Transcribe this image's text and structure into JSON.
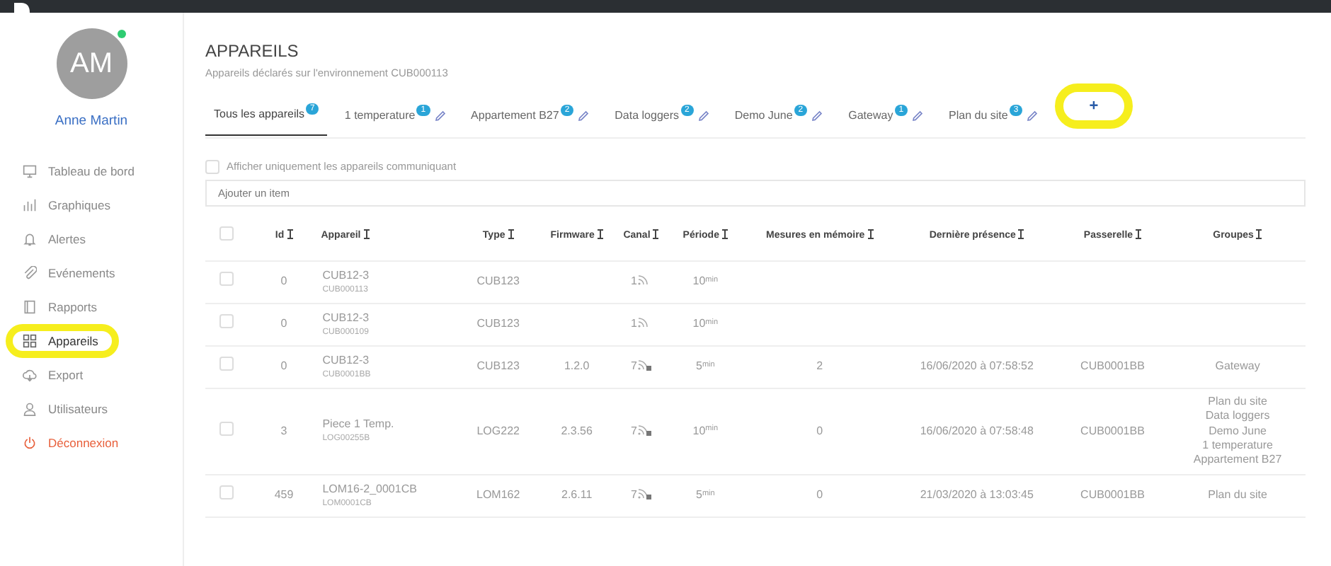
{
  "user": {
    "initials": "AM",
    "name": "Anne Martin",
    "online": true
  },
  "sidebar": {
    "items": [
      {
        "label": "Tableau de bord",
        "selected": false,
        "annotated": false,
        "kind": "nav"
      },
      {
        "label": "Graphiques",
        "selected": false,
        "annotated": false,
        "kind": "nav"
      },
      {
        "label": "Alertes",
        "selected": false,
        "annotated": false,
        "kind": "nav"
      },
      {
        "label": "Evénements",
        "selected": false,
        "annotated": false,
        "kind": "nav"
      },
      {
        "label": "Rapports",
        "selected": false,
        "annotated": false,
        "kind": "nav"
      },
      {
        "label": "Appareils",
        "selected": true,
        "annotated": true,
        "kind": "nav"
      },
      {
        "label": "Export",
        "selected": false,
        "annotated": false,
        "kind": "nav"
      },
      {
        "label": "Utilisateurs",
        "selected": false,
        "annotated": false,
        "kind": "nav"
      },
      {
        "label": "Déconnexion",
        "selected": false,
        "annotated": false,
        "kind": "logout"
      }
    ]
  },
  "page": {
    "title": "APPAREILS",
    "subtitle": "Appareils déclarés sur l'environnement CUB000113"
  },
  "tabs": [
    {
      "label": "Tous les appareils",
      "count": "7",
      "selected": true,
      "editable": false
    },
    {
      "label": "1 temperature",
      "count": "1",
      "selected": false,
      "editable": true
    },
    {
      "label": "Appartement B27",
      "count": "2",
      "selected": false,
      "editable": true
    },
    {
      "label": "Data loggers",
      "count": "2",
      "selected": false,
      "editable": true
    },
    {
      "label": "Demo June",
      "count": "2",
      "selected": false,
      "editable": true
    },
    {
      "label": "Gateway",
      "count": "1",
      "selected": false,
      "editable": true
    },
    {
      "label": "Plan du site",
      "count": "3",
      "selected": false,
      "editable": true
    }
  ],
  "add_tab": {
    "label": "+",
    "annotated": true
  },
  "filter": {
    "label": "Afficher uniquement les appareils communiquant",
    "checked": false
  },
  "add_item": {
    "placeholder": "Ajouter un item"
  },
  "table": {
    "all_checked": false,
    "columns": [
      "Id",
      "Appareil",
      "Type",
      "Firmware",
      "Canal",
      "Période",
      "Mesures en mémoire",
      "Dernière présence",
      "Passerelle",
      "Groupes"
    ],
    "rows": [
      {
        "checked": false,
        "id": "0",
        "name": "CUB12-3",
        "serial": "CUB000113",
        "type": "CUB123",
        "firmware": "",
        "channel": "1",
        "secured": false,
        "period": "10$^{min}$",
        "measures": "",
        "last_seen": "",
        "gateway": "",
        "groups": []
      },
      {
        "checked": false,
        "id": "0",
        "name": "CUB12-3",
        "serial": "CUB000109",
        "type": "CUB123",
        "firmware": "",
        "channel": "1",
        "secured": false,
        "period": "10$^{min}$",
        "measures": "",
        "last_seen": "",
        "gateway": "",
        "groups": []
      },
      {
        "checked": false,
        "id": "0",
        "name": "CUB12-3",
        "serial": "CUB0001BB",
        "type": "CUB123",
        "firmware": "1.2.0",
        "channel": "7",
        "secured": true,
        "period": "5$^{min}$",
        "measures": "2",
        "last_seen": "16/06/2020 à 07:58:52",
        "gateway": "CUB0001BB",
        "groups": [
          "Gateway"
        ]
      },
      {
        "checked": false,
        "id": "3",
        "name": "Piece 1 Temp.",
        "serial": "LOG00255B",
        "type": "LOG222",
        "firmware": "2.3.56",
        "channel": "7",
        "secured": true,
        "period": "10$^{min}$",
        "measures": "0",
        "last_seen": "16/06/2020 à 07:58:48",
        "gateway": "CUB0001BB",
        "groups": [
          "Plan du site",
          "Data loggers",
          "Demo June",
          "1 temperature",
          "Appartement B27"
        ]
      },
      {
        "checked": false,
        "id": "459",
        "name": "LOM16-2_0001CB",
        "serial": "LOM0001CB",
        "type": "LOM162",
        "firmware": "2.6.11",
        "channel": "7",
        "secured": true,
        "period": "5$^{min}$",
        "measures": "0",
        "last_seen": "21/03/2020 à 13:03:45",
        "gateway": "CUB0001BB",
        "groups": [
          "Plan du site"
        ]
      }
    ]
  }
}
